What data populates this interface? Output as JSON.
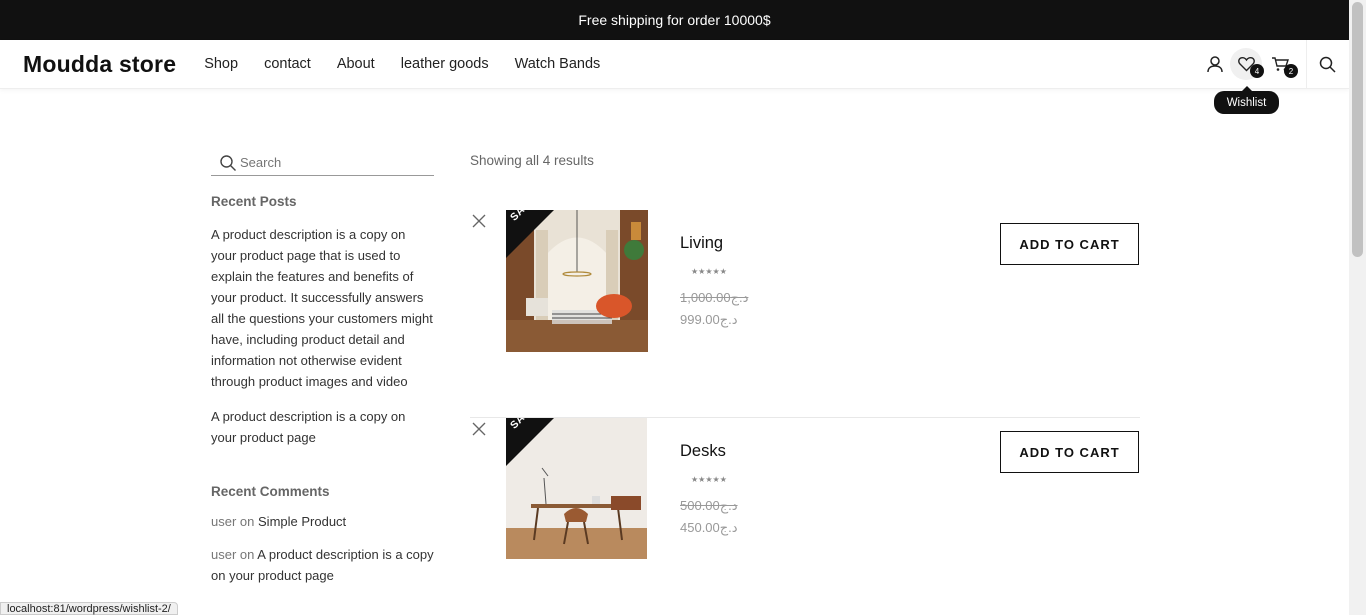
{
  "topbar": {
    "text": "Free shipping for order 10000$"
  },
  "header": {
    "logo": "Moudda store",
    "nav": [
      "Shop",
      "contact",
      "About",
      "leather goods",
      "Watch Bands"
    ],
    "wishlist_count": "4",
    "cart_count": "2",
    "tooltip": "Wishlist"
  },
  "sidebar": {
    "search_placeholder": "Search",
    "recent_posts_title": "Recent Posts",
    "posts": [
      "A product description is a copy on your product page that is used to explain the features and benefits of your product. It successfully answers all the questions your customers might have, including product detail and information not otherwise evident through product images and video",
      "A product description is a copy on your product page"
    ],
    "recent_comments_title": "Recent Comments",
    "comments": [
      {
        "author": "user",
        "on": "on",
        "link": "Simple Product"
      },
      {
        "author": "user",
        "on": "on",
        "link": "A product description is a copy on your product page"
      }
    ]
  },
  "results_text": "Showing all 4 results",
  "products": [
    {
      "name": "Living",
      "sale": "SALE!",
      "stars": "★★★★★",
      "old_price": "1,000.00د.ج",
      "new_price": "999.00د.ج",
      "button": "ADD TO CART"
    },
    {
      "name": "Desks",
      "sale": "SALE!",
      "stars": "★★★★★",
      "old_price": "500.00د.ج",
      "new_price": "450.00د.ج",
      "button": "ADD TO CART"
    }
  ],
  "status_url": "localhost:81/wordpress/wishlist-2/"
}
